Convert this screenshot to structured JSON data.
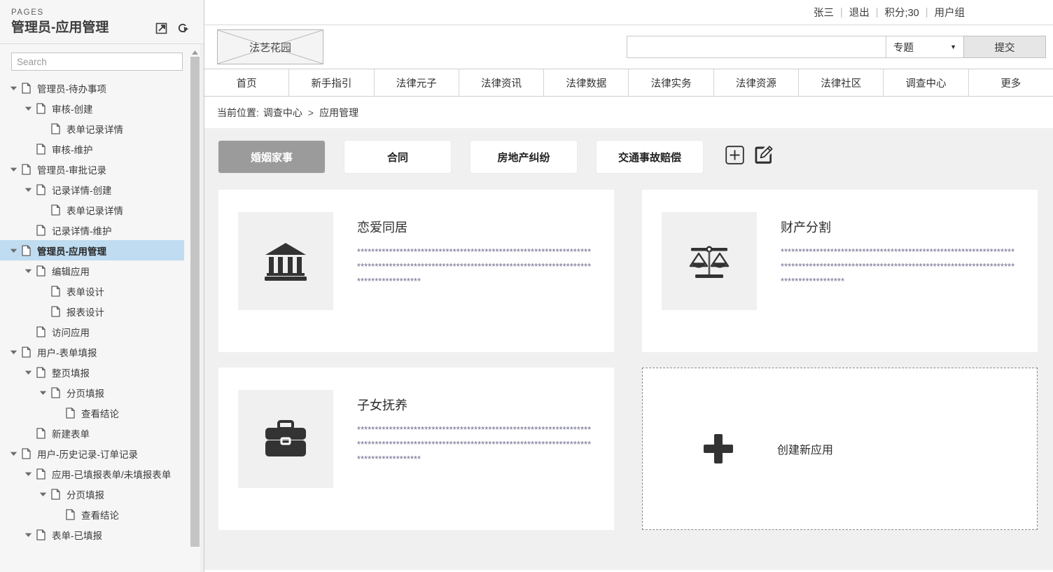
{
  "sidebar": {
    "section_label": "PAGES",
    "title": "管理员-应用管理",
    "icons": [
      {
        "name": "open-in-new-icon"
      },
      {
        "name": "reload-cursor-icon"
      }
    ],
    "search_placeholder": "Search",
    "tree": [
      {
        "label": "管理员-待办事项",
        "depth": 0,
        "expanded": true,
        "selected": false
      },
      {
        "label": "审核-创建",
        "depth": 1,
        "expanded": true,
        "selected": false
      },
      {
        "label": "表单记录详情",
        "depth": 2,
        "expanded": null,
        "selected": false
      },
      {
        "label": "审核-维护",
        "depth": 1,
        "expanded": null,
        "selected": false
      },
      {
        "label": "管理员-审批记录",
        "depth": 0,
        "expanded": true,
        "selected": false
      },
      {
        "label": "记录详情-创建",
        "depth": 1,
        "expanded": true,
        "selected": false
      },
      {
        "label": "表单记录详情",
        "depth": 2,
        "expanded": null,
        "selected": false
      },
      {
        "label": "记录详情-维护",
        "depth": 1,
        "expanded": null,
        "selected": false
      },
      {
        "label": "管理员-应用管理",
        "depth": 0,
        "expanded": true,
        "selected": true
      },
      {
        "label": "编辑应用",
        "depth": 1,
        "expanded": true,
        "selected": false
      },
      {
        "label": "表单设计",
        "depth": 2,
        "expanded": null,
        "selected": false
      },
      {
        "label": "报表设计",
        "depth": 2,
        "expanded": null,
        "selected": false
      },
      {
        "label": "访问应用",
        "depth": 1,
        "expanded": null,
        "selected": false
      },
      {
        "label": "用户-表单填报",
        "depth": 0,
        "expanded": true,
        "selected": false
      },
      {
        "label": "整页填报",
        "depth": 1,
        "expanded": true,
        "selected": false
      },
      {
        "label": "分页填报",
        "depth": 2,
        "expanded": true,
        "selected": false
      },
      {
        "label": "查看结论",
        "depth": 3,
        "expanded": null,
        "selected": false
      },
      {
        "label": "新建表单",
        "depth": 1,
        "expanded": null,
        "selected": false
      },
      {
        "label": "用户-历史记录-订单记录",
        "depth": 0,
        "expanded": true,
        "selected": false
      },
      {
        "label": "应用-已填报表单/未填报表单",
        "depth": 1,
        "expanded": true,
        "selected": false
      },
      {
        "label": "分页填报",
        "depth": 2,
        "expanded": true,
        "selected": false
      },
      {
        "label": "查看结论",
        "depth": 3,
        "expanded": null,
        "selected": false
      },
      {
        "label": "表单-已填报",
        "depth": 1,
        "expanded": true,
        "selected": false
      }
    ]
  },
  "topbar": {
    "user_name": "张三",
    "logout": "退出",
    "points": "积分;30",
    "user_group": "用户组",
    "separator": "|"
  },
  "brand": {
    "logo_text": "法艺花园"
  },
  "search": {
    "value": "",
    "placeholder": "",
    "category_selected": "专题",
    "submit_label": "提交"
  },
  "nav": {
    "items": [
      "首页",
      "新手指引",
      "法律元子",
      "法律资讯",
      "法律数据",
      "法律实务",
      "法律资源",
      "法律社区",
      "调查中心",
      "更多"
    ]
  },
  "breadcrumb": {
    "prefix": "当前位置:",
    "parent": "调查中心",
    "chevron": ">",
    "current": "应用管理"
  },
  "categories": {
    "tabs": [
      {
        "label": "婚姻家事",
        "active": true
      },
      {
        "label": "合同",
        "active": false
      },
      {
        "label": "房地产纠纷",
        "active": false
      },
      {
        "label": "交通事故赔偿",
        "active": false
      }
    ],
    "actions": [
      {
        "name": "add-category-icon"
      },
      {
        "name": "edit-category-icon"
      }
    ]
  },
  "apps": {
    "cards": [
      {
        "title": "恋爱同居",
        "icon": "bank-columns-icon",
        "desc": "******************************************************************************************************************************************************"
      },
      {
        "title": "财产分割",
        "icon": "scales-of-justice-icon",
        "desc": "******************************************************************************************************************************************************"
      },
      {
        "title": "子女抚养",
        "icon": "briefcase-icon",
        "desc": "******************************************************************************************************************************************************"
      }
    ],
    "create_card": {
      "label": "创建新应用",
      "icon": "plus-icon"
    }
  },
  "colors": {
    "active_tab_bg": "#9b9b9b",
    "content_bg": "#f0f0f0",
    "tree_selected_bg": "#bfdcf0",
    "card_bg": "#ffffff",
    "thumb_bg": "#f0f0f0",
    "desc_text": "#6d6d8f"
  }
}
